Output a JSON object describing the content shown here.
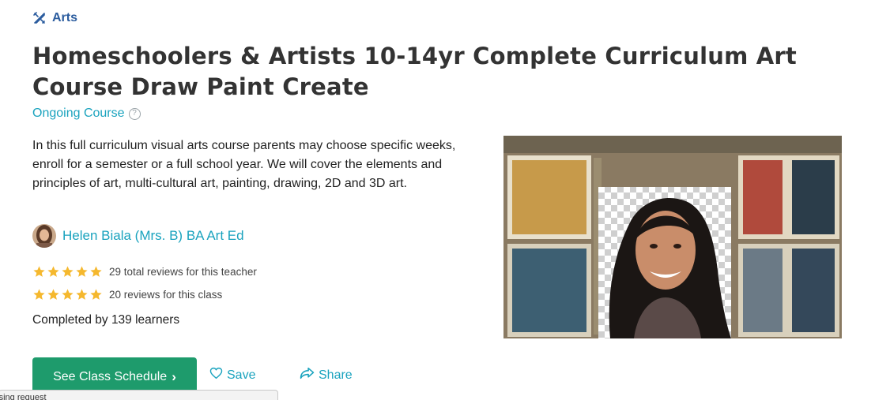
{
  "category": {
    "label": "Arts",
    "icon": "brush-pencil-icon",
    "color": "#2b5c9e"
  },
  "course": {
    "title": "Homeschoolers & Artists 10-14yr Complete Curriculum Art Course Draw Paint Create",
    "type_label": "Ongoing Course",
    "type_help_icon": "question-circle-icon",
    "description": "In this full curriculum visual arts course parents may choose specific weeks, enroll for a semester or a full school year. We will cover the elements and principles of art, multi-cultural art, painting, drawing, 2D and 3D art."
  },
  "teacher": {
    "name": "Helen Biala (Mrs. B) BA Art Ed"
  },
  "ratings": {
    "teacher_stars": 5,
    "teacher_reviews": "29 total reviews for this teacher",
    "class_stars": 5,
    "class_reviews": "20 reviews for this class",
    "star_color": "#f5b82e"
  },
  "completed": "Completed by 139 learners",
  "actions": {
    "schedule_label": "See Class Schedule",
    "save_label": "Save",
    "share_label": "Share"
  },
  "status_bar": {
    "text": "essing request"
  },
  "colors": {
    "accent": "#1aa3be",
    "primary_button": "#1e9b6c"
  }
}
